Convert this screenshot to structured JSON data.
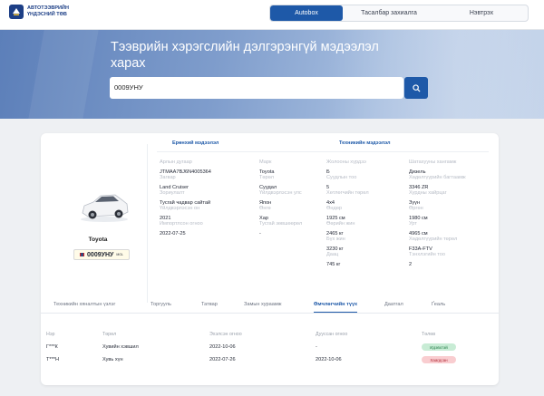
{
  "logo": {
    "line1": "АВТОТЭЭВРИЙН",
    "line2": "ҮНДЭСНИЙ ТӨВ",
    "color": "#1d3f86"
  },
  "nav": {
    "tabs": [
      "Autobox",
      "Тасалбар захиалга",
      "Нэвтрэх"
    ],
    "accent": "#1e59a8"
  },
  "hero": {
    "title": "Тээврийн хэрэгслийн дэлгэрэнгүй мэдээлэл харах"
  },
  "search": {
    "value": "0009УНУ"
  },
  "vehicle": {
    "name": "Toyota",
    "plate": "0009УНУ",
    "plate_suffix": "MGL"
  },
  "sections": {
    "general": "Ерөнхий мэдээлэл",
    "technical": "Техникийн мэдээлэл"
  },
  "general_fields": [
    {
      "label": "Арлын дугаар",
      "value": "JTMAA7BJ6N4005364"
    },
    {
      "label": "Марк",
      "value": "Toyota"
    },
    {
      "label": "Загвар",
      "value": "Land Cruiser"
    },
    {
      "label": "Төрөл",
      "value": "Суудал"
    },
    {
      "label": "Зориулалт",
      "value": "Тусгай чадвар сайтай"
    },
    {
      "label": "Үйлдвэрлэсэн улс",
      "value": "Япон"
    },
    {
      "label": "Үйлдвэрлэсэн он",
      "value": "2021"
    },
    {
      "label": "Өнгө",
      "value": "Хар"
    },
    {
      "label": "Импортлсон огноо",
      "value": "2022-07-25"
    },
    {
      "label": "Тусгай зөвшөөрөл",
      "value": "-"
    }
  ],
  "technical_fields": [
    {
      "label": "Жолооны хүрдээ",
      "value": "Б"
    },
    {
      "label": "Шатахууны хангамж",
      "value": "Дизель"
    },
    {
      "label": "Суудлын тоо",
      "value": "5"
    },
    {
      "label": "Хөдөлгүүрийн багтаамж",
      "value": "3346 ZR"
    },
    {
      "label": "Хөтлөгчийн төрөл",
      "value": "4x4"
    },
    {
      "label": "Хурдны хайрцаг",
      "value": "Зүүн"
    },
    {
      "label": "Өндөр",
      "value": "1925 см"
    },
    {
      "label": "Өргөн",
      "value": "1980 см"
    },
    {
      "label": "Өөрийн жин",
      "value": "2465 кг"
    },
    {
      "label": "Урт",
      "value": "4965 см"
    },
    {
      "label": "Бүх жин",
      "value": "3230 кг"
    },
    {
      "label": "Хөдөлгүүрийн төрөл",
      "value": "F33A-FTV"
    },
    {
      "label": "Даац",
      "value": "745 кг"
    },
    {
      "label": "Тэнхлэгийн тоо",
      "value": "2"
    }
  ],
  "tabs": [
    {
      "label": "Техникийн хяналтын үзлэг",
      "active": false
    },
    {
      "label": "Торгууль",
      "active": false
    },
    {
      "label": "Татвар",
      "active": false
    },
    {
      "label": "Замын хураамж",
      "active": false
    },
    {
      "label": "Өмчлөгчийн түүх",
      "active": true
    },
    {
      "label": "Даатгал",
      "active": false
    },
    {
      "label": "Ґеаль",
      "active": false
    }
  ],
  "owners_table": {
    "headers": [
      "Нэр",
      "Төрөл",
      "Эхэлсэн огноо",
      "Дууссан огноо",
      "Төлөв"
    ],
    "rows": [
      {
        "name": "Г***К",
        "type": "Хувийн хэвшил",
        "start": "2022-10-06",
        "end": "-",
        "status": "Идэвхтэй",
        "status_color": "#c8ecd5"
      },
      {
        "name": "Т***Н",
        "type": "Хувь хүн",
        "start": "2022-07-26",
        "end": "2022-10-06",
        "status": "Хаагдсан",
        "status_color": "#f9cdd0"
      }
    ]
  }
}
